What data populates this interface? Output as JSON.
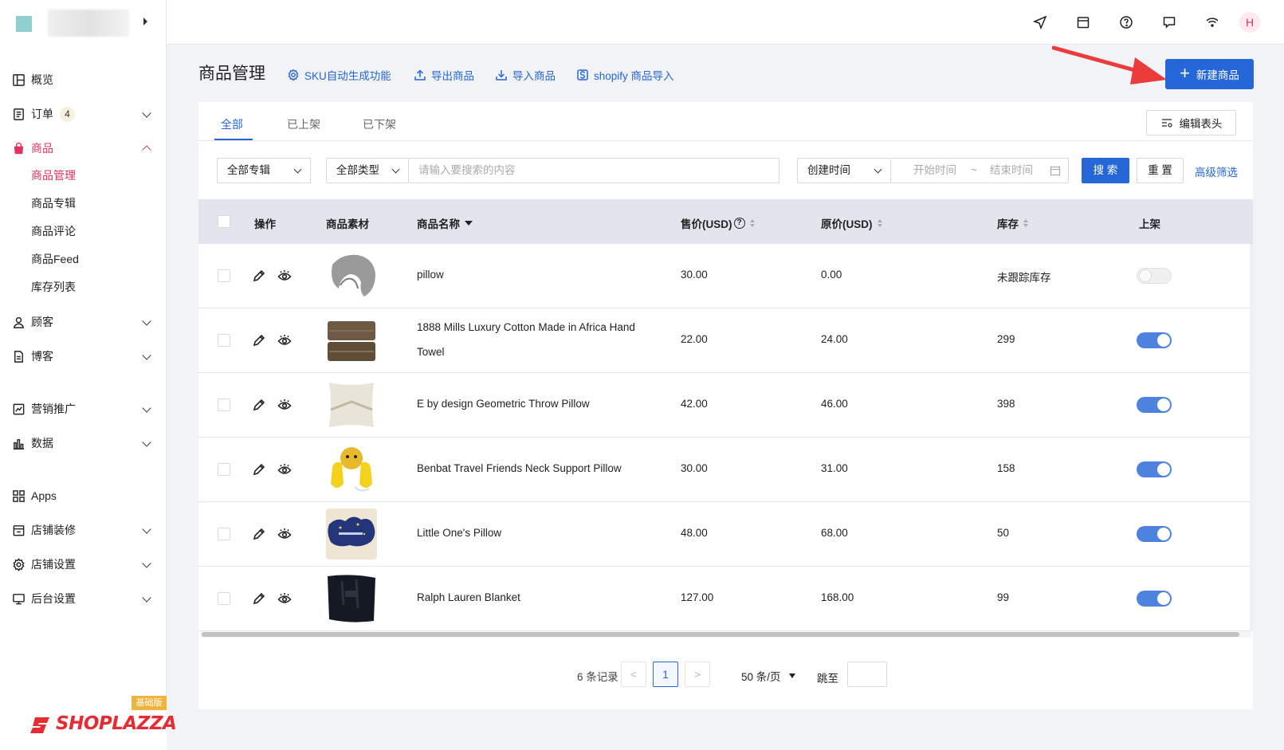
{
  "sidebar": {
    "items": [
      {
        "label": "概览",
        "icon": "overview-icon"
      },
      {
        "label": "订单",
        "icon": "order-icon",
        "badge": "4"
      },
      {
        "label": "商品",
        "icon": "bag-icon"
      },
      {
        "label": "顾客",
        "icon": "user-icon"
      },
      {
        "label": "博客",
        "icon": "document-icon"
      },
      {
        "label": "营销推广",
        "icon": "marketing-icon"
      },
      {
        "label": "数据",
        "icon": "bar-chart-icon"
      },
      {
        "label": "Apps",
        "icon": "apps-icon"
      },
      {
        "label": "店铺装修",
        "icon": "store-icon"
      },
      {
        "label": "店铺设置",
        "icon": "gear-icon"
      },
      {
        "label": "后台设置",
        "icon": "monitor-icon"
      }
    ],
    "product_sub": [
      "商品管理",
      "商品专辑",
      "商品评论",
      "商品Feed",
      "库存列表"
    ],
    "brand": {
      "tag": "基础版",
      "name": "SHOPLAZZA"
    }
  },
  "topbar": {
    "avatar": "H"
  },
  "header": {
    "title": "商品管理",
    "links": [
      "SKU自动生成功能",
      "导出商品",
      "导入商品",
      "shopify 商品导入"
    ],
    "new_button": "新建商品"
  },
  "tabs": [
    "全部",
    "已上架",
    "已下架"
  ],
  "edit_columns": "编辑表头",
  "filters": {
    "collection": "全部专辑",
    "type": "全部类型",
    "search_placeholder": "请输入要搜索的内容",
    "time_field": "创建时间",
    "start": "开始时间",
    "sep": "~",
    "end": "结束时间",
    "search_btn": "搜 索",
    "reset_btn": "重 置",
    "advanced": "高级筛选"
  },
  "table": {
    "columns": [
      "操作",
      "商品素材",
      "商品名称",
      "售价(USD)",
      "原价(USD)",
      "库存",
      "上架"
    ],
    "price_help": "?",
    "rows": [
      {
        "name": "pillow",
        "name2": "",
        "price": "30.00",
        "compare": "0.00",
        "stock": "未跟踪库存",
        "published": false
      },
      {
        "name": "1888 Mills Luxury Cotton Made in Africa Hand",
        "name2": "Towel",
        "price": "22.00",
        "compare": "24.00",
        "stock": "299",
        "published": true
      },
      {
        "name": "E by design Geometric Throw Pillow",
        "name2": "",
        "price": "42.00",
        "compare": "46.00",
        "stock": "398",
        "published": true
      },
      {
        "name": "Benbat Travel Friends Neck Support Pillow",
        "name2": "",
        "price": "30.00",
        "compare": "31.00",
        "stock": "158",
        "published": true
      },
      {
        "name": "Little One's Pillow",
        "name2": "",
        "price": "48.00",
        "compare": "68.00",
        "stock": "50",
        "published": true
      },
      {
        "name": "Ralph Lauren Blanket",
        "name2": "",
        "price": "127.00",
        "compare": "168.00",
        "stock": "99",
        "published": true
      }
    ]
  },
  "pagination": {
    "total": "6 条记录",
    "prev": "<",
    "page": "1",
    "next": ">",
    "page_size": "50 条/页",
    "jump": "跳至"
  },
  "colors": {
    "accent": "#2566d8",
    "brand": "#e0325f",
    "toggle_on": "#4e82df"
  }
}
